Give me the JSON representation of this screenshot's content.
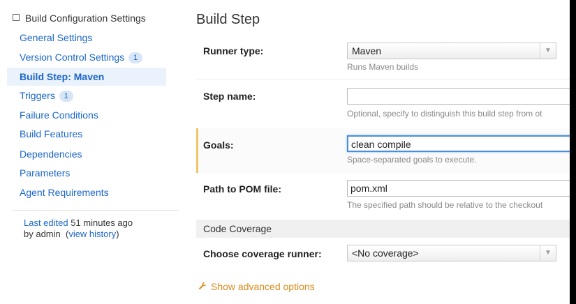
{
  "sidebar": {
    "header": "Build Configuration Settings",
    "items": [
      {
        "label": "General Settings",
        "badge": ""
      },
      {
        "label": "Version Control Settings",
        "badge": "1"
      },
      {
        "label": "Build Step: Maven",
        "badge": ""
      },
      {
        "label": "Triggers",
        "badge": "1"
      },
      {
        "label": "Failure Conditions",
        "badge": ""
      },
      {
        "label": "Build Features",
        "badge": ""
      },
      {
        "label": "Dependencies",
        "badge": ""
      },
      {
        "label": "Parameters",
        "badge": ""
      },
      {
        "label": "Agent Requirements",
        "badge": ""
      }
    ],
    "history": {
      "prefix": "Last edited",
      "time": "51 minutes ago",
      "by": "by admin",
      "link": "view history"
    }
  },
  "main": {
    "title": "Build Step",
    "runner_type": {
      "label": "Runner type:",
      "value": "Maven",
      "hint": "Runs Maven builds"
    },
    "step_name": {
      "label": "Step name:",
      "value": "",
      "hint": "Optional, specify to distinguish this build step from ot"
    },
    "goals": {
      "label": "Goals:",
      "value": "clean compile",
      "hint": "Space-separated goals to execute."
    },
    "pom": {
      "label": "Path to POM file:",
      "value": "pom.xml",
      "hint": "The specified path should be relative to the checkout"
    },
    "coverage_section": "Code Coverage",
    "coverage_runner": {
      "label": "Choose coverage runner:",
      "value": "<No coverage>"
    },
    "advanced": "Show advanced options"
  },
  "colors": {
    "link": "#1a66c9",
    "accent": "#d98b1c",
    "focus": "#4a90d9"
  }
}
